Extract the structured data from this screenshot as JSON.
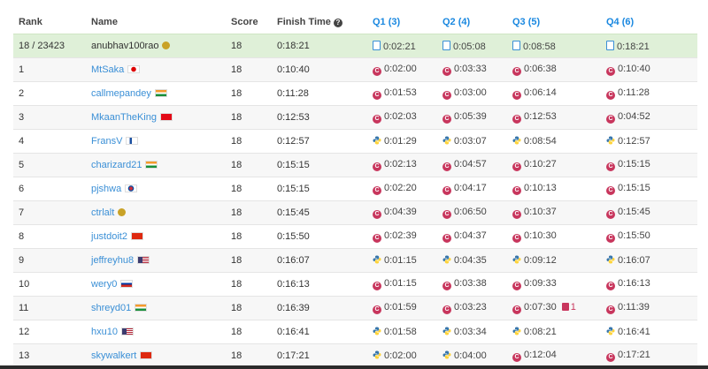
{
  "headers": {
    "rank": "Rank",
    "name": "Name",
    "score": "Score",
    "finish_time": "Finish Time",
    "q1": "Q1 (3)",
    "q2": "Q2 (4)",
    "q3": "Q3 (5)",
    "q4": "Q4 (6)"
  },
  "me": {
    "rank": "18 / 23423",
    "name": "anubhav100rao",
    "score": "18",
    "finish": "0:18:21",
    "q": [
      "0:02:21",
      "0:05:08",
      "0:08:58",
      "0:18:21"
    ]
  },
  "rows": [
    {
      "rank": "1",
      "name": "MtSaka",
      "score": "18",
      "finish": "0:10:40",
      "q": [
        "0:02:00",
        "0:03:33",
        "0:06:38",
        "0:10:40"
      ],
      "lang": [
        "cpp",
        "cpp",
        "cpp",
        "cpp"
      ],
      "flag": "japan-flag"
    },
    {
      "rank": "2",
      "name": "callmepandey",
      "score": "18",
      "finish": "0:11:28",
      "q": [
        "0:01:53",
        "0:03:00",
        "0:06:14",
        "0:11:28"
      ],
      "lang": [
        "cpp",
        "cpp",
        "cpp",
        "cpp"
      ],
      "flag": "india-flag"
    },
    {
      "rank": "3",
      "name": "MkaanTheKing",
      "score": "18",
      "finish": "0:12:53",
      "q": [
        "0:02:03",
        "0:05:39",
        "0:12:53",
        "0:04:52"
      ],
      "lang": [
        "cpp",
        "cpp",
        "cpp",
        "cpp"
      ],
      "flag": "turkey-flag"
    },
    {
      "rank": "4",
      "name": "FransV",
      "score": "18",
      "finish": "0:12:57",
      "q": [
        "0:01:29",
        "0:03:07",
        "0:08:54",
        "0:12:57"
      ],
      "lang": [
        "py",
        "py",
        "py",
        "py"
      ],
      "flag": "finland-flag"
    },
    {
      "rank": "5",
      "name": "charizard21",
      "score": "18",
      "finish": "0:15:15",
      "q": [
        "0:02:13",
        "0:04:57",
        "0:10:27",
        "0:15:15"
      ],
      "lang": [
        "cpp",
        "cpp",
        "cpp",
        "cpp"
      ],
      "flag": "india-flag"
    },
    {
      "rank": "6",
      "name": "pjshwa",
      "score": "18",
      "finish": "0:15:15",
      "q": [
        "0:02:20",
        "0:04:17",
        "0:10:13",
        "0:15:15"
      ],
      "lang": [
        "cpp",
        "cpp",
        "cpp",
        "cpp"
      ],
      "flag": "korea-flag"
    },
    {
      "rank": "7",
      "name": "ctrlalt",
      "score": "18",
      "finish": "0:15:45",
      "q": [
        "0:04:39",
        "0:06:50",
        "0:10:37",
        "0:15:45"
      ],
      "lang": [
        "cpp",
        "cpp",
        "cpp",
        "cpp"
      ],
      "flag": ""
    },
    {
      "rank": "8",
      "name": "justdoit2",
      "score": "18",
      "finish": "0:15:50",
      "q": [
        "0:02:39",
        "0:04:37",
        "0:10:30",
        "0:15:50"
      ],
      "lang": [
        "cpp",
        "cpp",
        "cpp",
        "cpp"
      ],
      "flag": "china-flag"
    },
    {
      "rank": "9",
      "name": "jeffreyhu8",
      "score": "18",
      "finish": "0:16:07",
      "q": [
        "0:01:15",
        "0:04:35",
        "0:09:12",
        "0:16:07"
      ],
      "lang": [
        "py",
        "py",
        "py",
        "py"
      ],
      "flag": "usa-flag"
    },
    {
      "rank": "10",
      "name": "wery0",
      "score": "18",
      "finish": "0:16:13",
      "q": [
        "0:01:15",
        "0:03:38",
        "0:09:33",
        "0:16:13"
      ],
      "lang": [
        "cpp",
        "cpp",
        "cpp",
        "cpp"
      ],
      "flag": "russia-flag"
    },
    {
      "rank": "11",
      "name": "shreyd01",
      "score": "18",
      "finish": "0:16:39",
      "q": [
        "0:01:59",
        "0:03:23",
        "0:07:30",
        "0:11:39"
      ],
      "lang": [
        "cpp",
        "cpp",
        "cpp",
        "cpp"
      ],
      "flag": "india-flag",
      "penalty": "1"
    },
    {
      "rank": "12",
      "name": "hxu10",
      "score": "18",
      "finish": "0:16:41",
      "q": [
        "0:01:58",
        "0:03:34",
        "0:08:21",
        "0:16:41"
      ],
      "lang": [
        "py",
        "py",
        "py",
        "py"
      ],
      "flag": "usa-flag"
    },
    {
      "rank": "13",
      "name": "skywalkert",
      "score": "18",
      "finish": "0:17:21",
      "q": [
        "0:02:00",
        "0:04:00",
        "0:12:04",
        "0:17:21"
      ],
      "lang": [
        "py",
        "py",
        "cpp",
        "cpp"
      ],
      "flag": "china-flag"
    }
  ],
  "colors": {
    "link": "#3a8fd6",
    "highlight_row": "#dff0d8",
    "cpp": "#c8365d"
  }
}
